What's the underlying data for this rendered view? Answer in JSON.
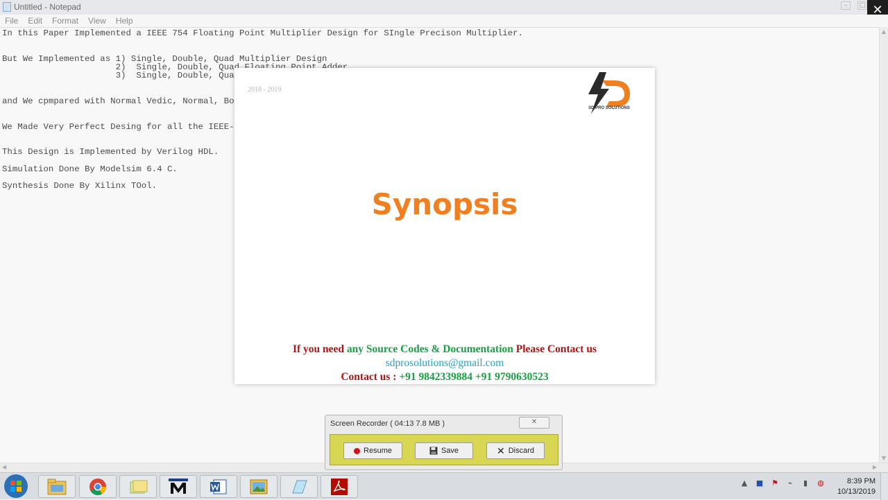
{
  "window": {
    "title": "Untitled - Notepad"
  },
  "menu": [
    "File",
    "Edit",
    "Format",
    "View",
    "Help"
  ],
  "editor_lines": [
    "In this Paper Implemented a IEEE 754 Floating Point Multiplier Design for SIngle Precison Multiplier.",
    "But We Implemented as 1) Single, Double, Quad Multiplier Design",
    "                      2)  Single, Double, Quad Floating Point Adder",
    "                      3)  Single, Double, Qua",
    "and We cpmpared with Normal Vedic, Normal, Bo",
    "We Made Very Perfect Desing for all the IEEE-",
    "This Design is Implemented by Verilog HDL.",
    "Simulation Done By Modelsim 6.4 C.",
    "Synthesis Done By Xilinx TOol."
  ],
  "slide": {
    "year": "2018 - 2019",
    "logo_text": "SD PRO SOLUTIONS",
    "title": "Synopsis",
    "contact_line1_a": "If you need ",
    "contact_line1_b": "any Source Codes & Documentation",
    "contact_line1_c": "  Please Contact us",
    "email": "sdprosolutions@gmail.com",
    "contact_label": "Contact us : ",
    "phones": "+91 9842339884 +91 9790630523"
  },
  "recorder": {
    "title": "Screen Recorder ( 04:13  7.8 MB )",
    "resume_label": "Resume",
    "save_label": "Save",
    "discard_label": "Discard"
  },
  "taskbar": {
    "time": "8:39 PM",
    "date": "10/13/2019"
  },
  "colors": {
    "title_orange": "#f07f22",
    "contact_red": "#b01313",
    "contact_green": "#1aa044",
    "email_cyan": "#1fa6c4",
    "recorder_panel": "#d8d652"
  }
}
